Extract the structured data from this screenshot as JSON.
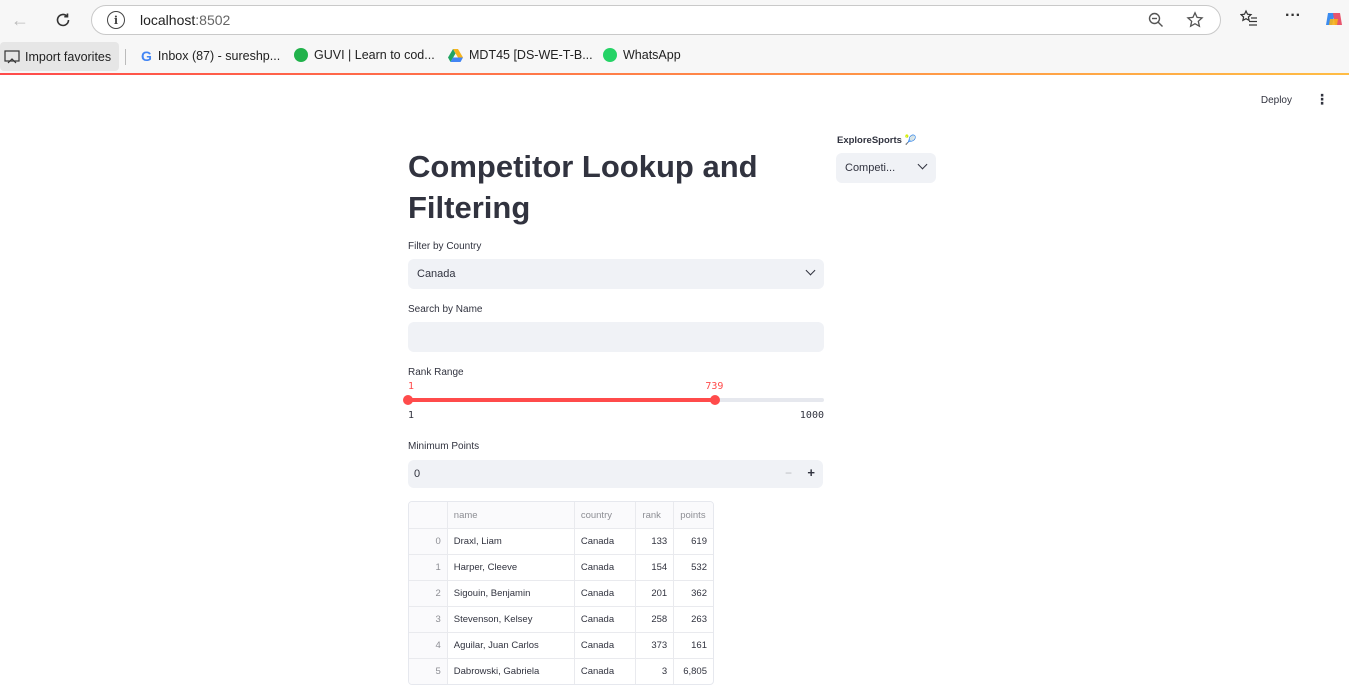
{
  "browser": {
    "url_host": "localhost",
    "url_port": ":8502",
    "bookmarks": {
      "import_favorites": "Import favorites",
      "inbox": "Inbox (87) - sureshp...",
      "guvi": "GUVI | Learn to cod...",
      "mdt": "MDT45 [DS-WE-T-B...",
      "whatsapp": "WhatsApp"
    },
    "colors": {
      "google_g": "#4285f4",
      "guvi": "#21b24b",
      "whatsapp": "#25d366"
    }
  },
  "header": {
    "deploy_label": "Deploy",
    "menu_icon": "⋮"
  },
  "main": {
    "title": "Competitor Lookup and Filtering",
    "country_filter": {
      "label": "Filter by Country",
      "value": "Canada"
    },
    "name_search": {
      "label": "Search by Name",
      "value": ""
    },
    "rank_range": {
      "label": "Rank Range",
      "low": 1,
      "high": 739,
      "min": 1,
      "max": 1000,
      "low_label": "1",
      "high_label": "739",
      "min_label": "1",
      "max_label": "1000"
    },
    "min_points": {
      "label": "Minimum Points",
      "value": "0",
      "minus": "−",
      "plus": "+"
    }
  },
  "table": {
    "columns": [
      "name",
      "country",
      "rank",
      "points"
    ],
    "rows": [
      {
        "idx": "0",
        "name": "Draxl, Liam",
        "country": "Canada",
        "rank": "133",
        "points": "619"
      },
      {
        "idx": "1",
        "name": "Harper, Cleeve",
        "country": "Canada",
        "rank": "154",
        "points": "532"
      },
      {
        "idx": "2",
        "name": "Sigouin, Benjamin",
        "country": "Canada",
        "rank": "201",
        "points": "362"
      },
      {
        "idx": "3",
        "name": "Stevenson, Kelsey",
        "country": "Canada",
        "rank": "258",
        "points": "263"
      },
      {
        "idx": "4",
        "name": "Aguilar, Juan Carlos",
        "country": "Canada",
        "rank": "373",
        "points": "161"
      },
      {
        "idx": "5",
        "name": "Dabrowski, Gabriela",
        "country": "Canada",
        "rank": "3",
        "points": "6,805"
      }
    ]
  },
  "sidebar": {
    "label": "ExploreSports 🎾",
    "select_value": "Competi..."
  },
  "accent_color": "#ff4b4b"
}
